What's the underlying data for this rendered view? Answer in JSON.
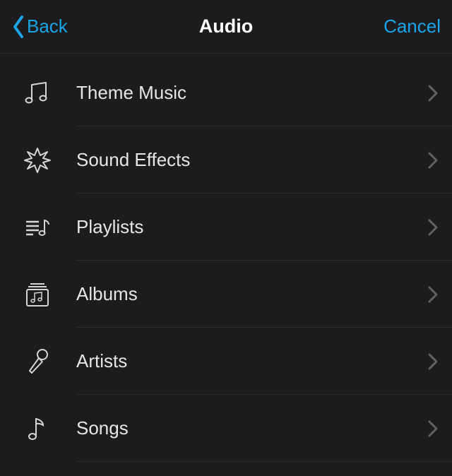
{
  "navbar": {
    "back_label": "Back",
    "title": "Audio",
    "cancel_label": "Cancel"
  },
  "list": {
    "items": [
      {
        "label": "Theme Music",
        "icon": "music-note"
      },
      {
        "label": "Sound Effects",
        "icon": "burst"
      },
      {
        "label": "Playlists",
        "icon": "playlist"
      },
      {
        "label": "Albums",
        "icon": "album"
      },
      {
        "label": "Artists",
        "icon": "microphone"
      },
      {
        "label": "Songs",
        "icon": "single-note"
      }
    ]
  },
  "colors": {
    "background": "#1c1c1e",
    "accent": "#1aa5e8",
    "text": "#e6e6e7",
    "icon": "#d5d5d6",
    "separator": "#2c2c2e"
  }
}
